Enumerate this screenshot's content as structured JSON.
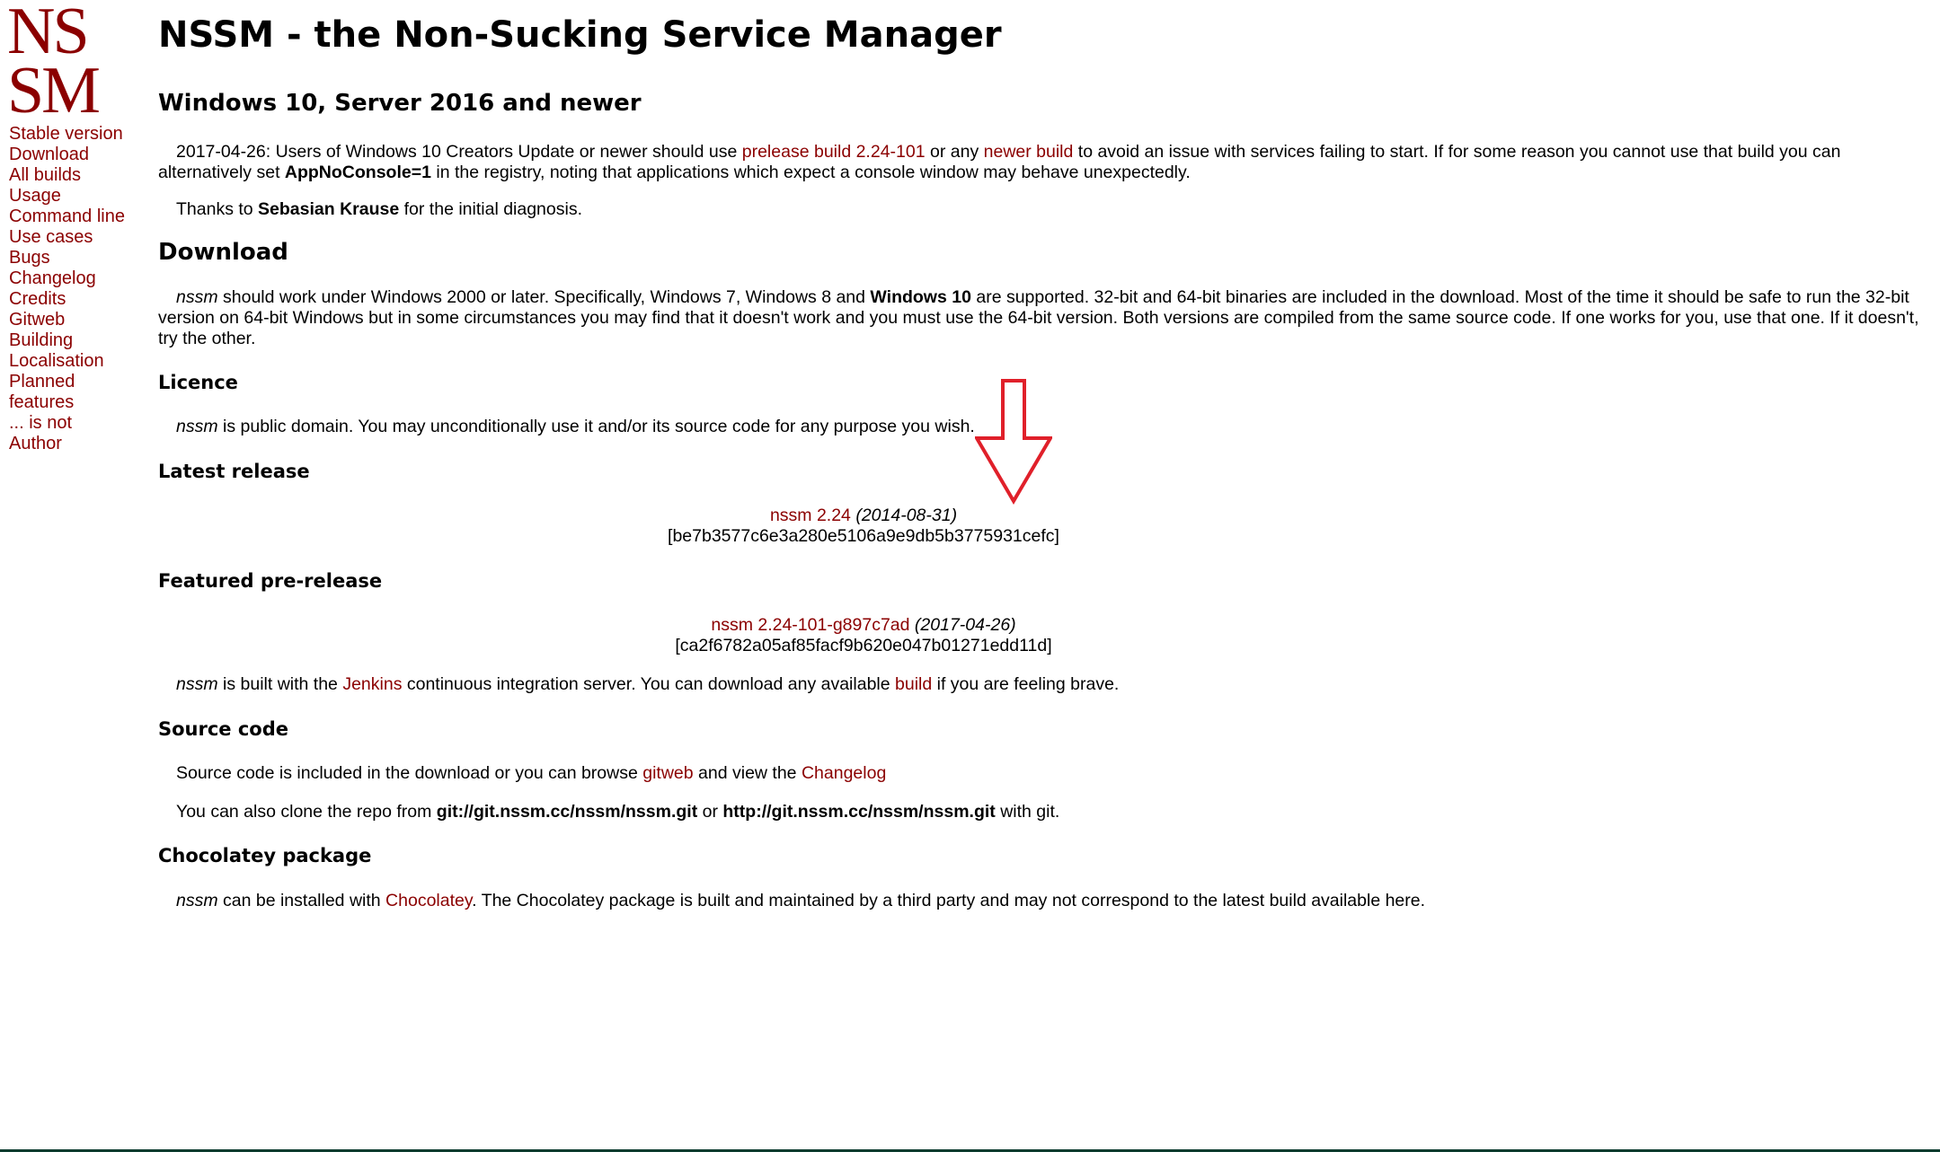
{
  "logo": {
    "line1": "NS",
    "line2": "SM"
  },
  "nav": [
    "Stable version",
    "Download",
    "All builds",
    "Usage",
    "Command line",
    "Use cases",
    "Bugs",
    "Changelog",
    "Credits",
    "Gitweb",
    "Building",
    "Localisation",
    "Planned",
    "features",
    "... is not",
    "Author"
  ],
  "title": "NSSM - the Non-Sucking Service Manager",
  "win10": {
    "heading": "Windows 10, Server 2016 and newer",
    "p1_a": "2017-04-26: Users of Windows 10 Creators Update or newer should use ",
    "p1_link1": "prelease build 2.24-101",
    "p1_b": " or any ",
    "p1_link2": "newer build",
    "p1_c": " to avoid an issue with services failing to start. If for some reason you cannot use that build you can alternatively set ",
    "p1_bold": "AppNoConsole=1",
    "p1_d": " in the registry, noting that applications which expect a console window may behave unexpectedly.",
    "p2_a": "Thanks to ",
    "p2_bold": "Sebasian Krause",
    "p2_b": " for the initial diagnosis."
  },
  "download": {
    "heading": "Download",
    "em": "nssm",
    "a": " should work under Windows 2000 or later. Specifically, Windows 7, Windows 8 and ",
    "bold": "Windows 10",
    "b": " are supported. 32-bit and 64-bit binaries are included in the download. Most of the time it should be safe to run the 32-bit version on 64-bit Windows but in some circumstances you may find that it doesn't work and you must use the 64-bit version. Both versions are compiled from the same source code. If one works for you, use that one. If it doesn't, try the other."
  },
  "licence": {
    "heading": "Licence",
    "em": "nssm",
    "text": " is public domain. You may unconditionally use it and/or its source code for any purpose you wish."
  },
  "latest": {
    "heading": "Latest release",
    "link": "nssm 2.24",
    "date": " (2014-08-31)",
    "hash": "[be7b3577c6e3a280e5106a9e9db5b3775931cefc]"
  },
  "prerelease": {
    "heading": "Featured pre-release",
    "link": "nssm 2.24-101-g897c7ad",
    "date": " (2017-04-26)",
    "hash": "[ca2f6782a05af85facf9b620e047b01271edd11d]",
    "em": "nssm",
    "a": " is built with the ",
    "link_jenkins": "Jenkins",
    "b": " continuous integration server. You can download any available ",
    "link_build": "build",
    "c": " if you are feeling brave."
  },
  "source": {
    "heading": "Source code",
    "p1_a": "Source code is included in the download or you can browse ",
    "p1_link1": "gitweb",
    "p1_b": " and view the ",
    "p1_link2": "Changelog",
    "p2_a": "You can also clone the repo from ",
    "p2_bold1": "git://git.nssm.cc/nssm/nssm.git",
    "p2_b": " or ",
    "p2_bold2": "http://git.nssm.cc/nssm/nssm.git",
    "p2_c": " with git."
  },
  "chocolatey": {
    "heading": "Chocolatey package",
    "em": "nssm",
    "a": " can be installed with ",
    "link": "Chocolatey",
    "b": ". The Chocolatey package is built and maintained by a third party and may not correspond to the latest build available here."
  },
  "colors": {
    "link": "#8b0000",
    "arrow": "#e0202a"
  }
}
